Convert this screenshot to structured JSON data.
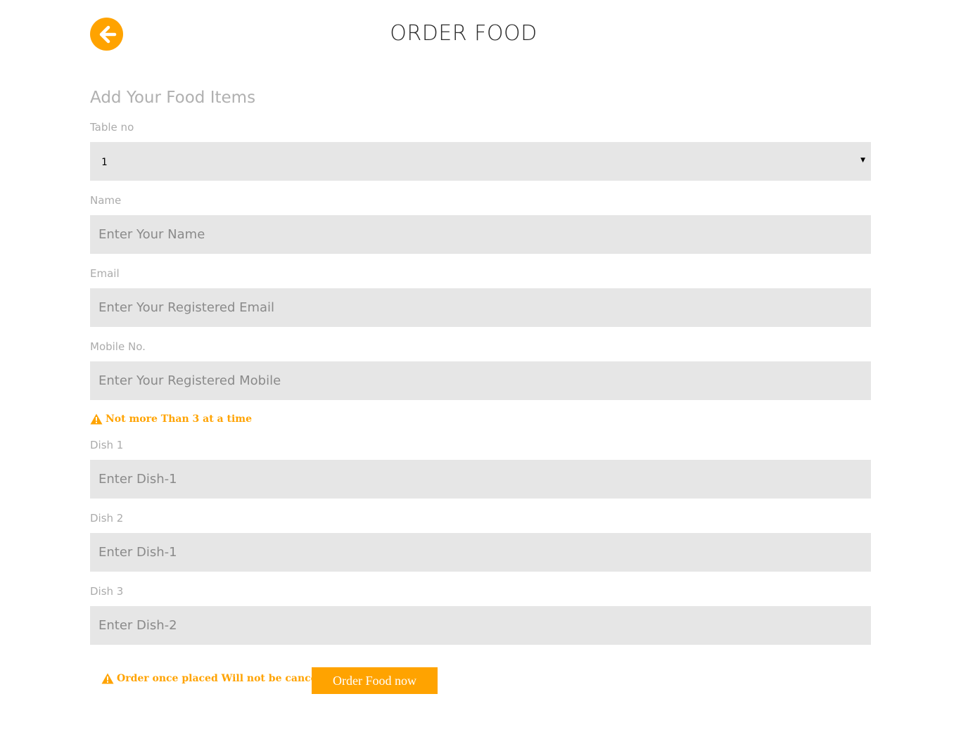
{
  "header": {
    "back_icon": "arrow-left-circle-icon",
    "title": "ORDER FOOD"
  },
  "form": {
    "section_title": "Add Your Food Items",
    "table": {
      "label": "Table no",
      "selected": "1"
    },
    "name": {
      "label": "Name",
      "placeholder": "Enter Your Name",
      "value": ""
    },
    "email": {
      "label": "Email",
      "placeholder": "Enter Your Registered Email",
      "value": ""
    },
    "mobile": {
      "label": "Mobile No.",
      "placeholder": "Enter Your Registered Mobile",
      "value": ""
    },
    "dish_warning": "Not more Than 3 at a time",
    "dishes": [
      {
        "label": "Dish 1",
        "placeholder": "Enter Dish-1"
      },
      {
        "label": "Dish 2",
        "placeholder": "Enter Dish-1"
      },
      {
        "label": "Dish 3",
        "placeholder": "Enter Dish-2"
      }
    ],
    "cancel_warning": "Order once placed Will not be cancelled",
    "submit_label": "Order Food now"
  },
  "colors": {
    "accent": "#ffa300",
    "field_bg": "#e6e6e6",
    "label": "#ababab"
  },
  "icons": {
    "warning": "warning-triangle-icon",
    "dropdown": "caret-down-icon"
  }
}
